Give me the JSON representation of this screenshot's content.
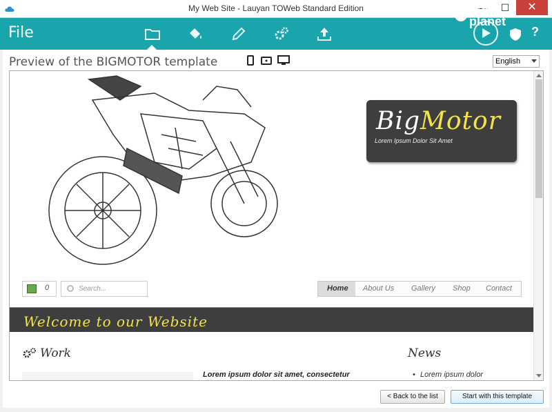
{
  "window": {
    "title": "My Web Site - Lauyan TOWeb Standard Edition",
    "minimize_glyph": "—",
    "maximize_glyph": "☐",
    "close_glyph": "✕"
  },
  "toolbar": {
    "file_label": "File",
    "icons": [
      "folder-icon",
      "paint-bucket-icon",
      "pencil-icon",
      "gears-icon",
      "upload-icon"
    ],
    "help_label": "?",
    "accent": "#1aa5ad"
  },
  "preview": {
    "title": "Preview of the BIGMOTOR template",
    "device_icons": [
      "phone-icon",
      "tablet-icon",
      "desktop-icon"
    ],
    "language": "English"
  },
  "site": {
    "logo_part1": "Big",
    "logo_part2": "Motor",
    "logo_tagline": "Lorem Ipsum Dolor Sit Amet",
    "cart_count": "0",
    "search_placeholder": "Search...",
    "menu": [
      "Home",
      "About Us",
      "Gallery",
      "Shop",
      "Contact"
    ],
    "welcome": "Welcome to our Website",
    "work_heading": "Work",
    "news_heading": "News",
    "work_text": "Lorem ipsum dolor sit amet, consectetur",
    "news_item": "Lorem ipsum dolor"
  },
  "buttons": {
    "back": "< Back to the list",
    "start": "Start with this template"
  }
}
